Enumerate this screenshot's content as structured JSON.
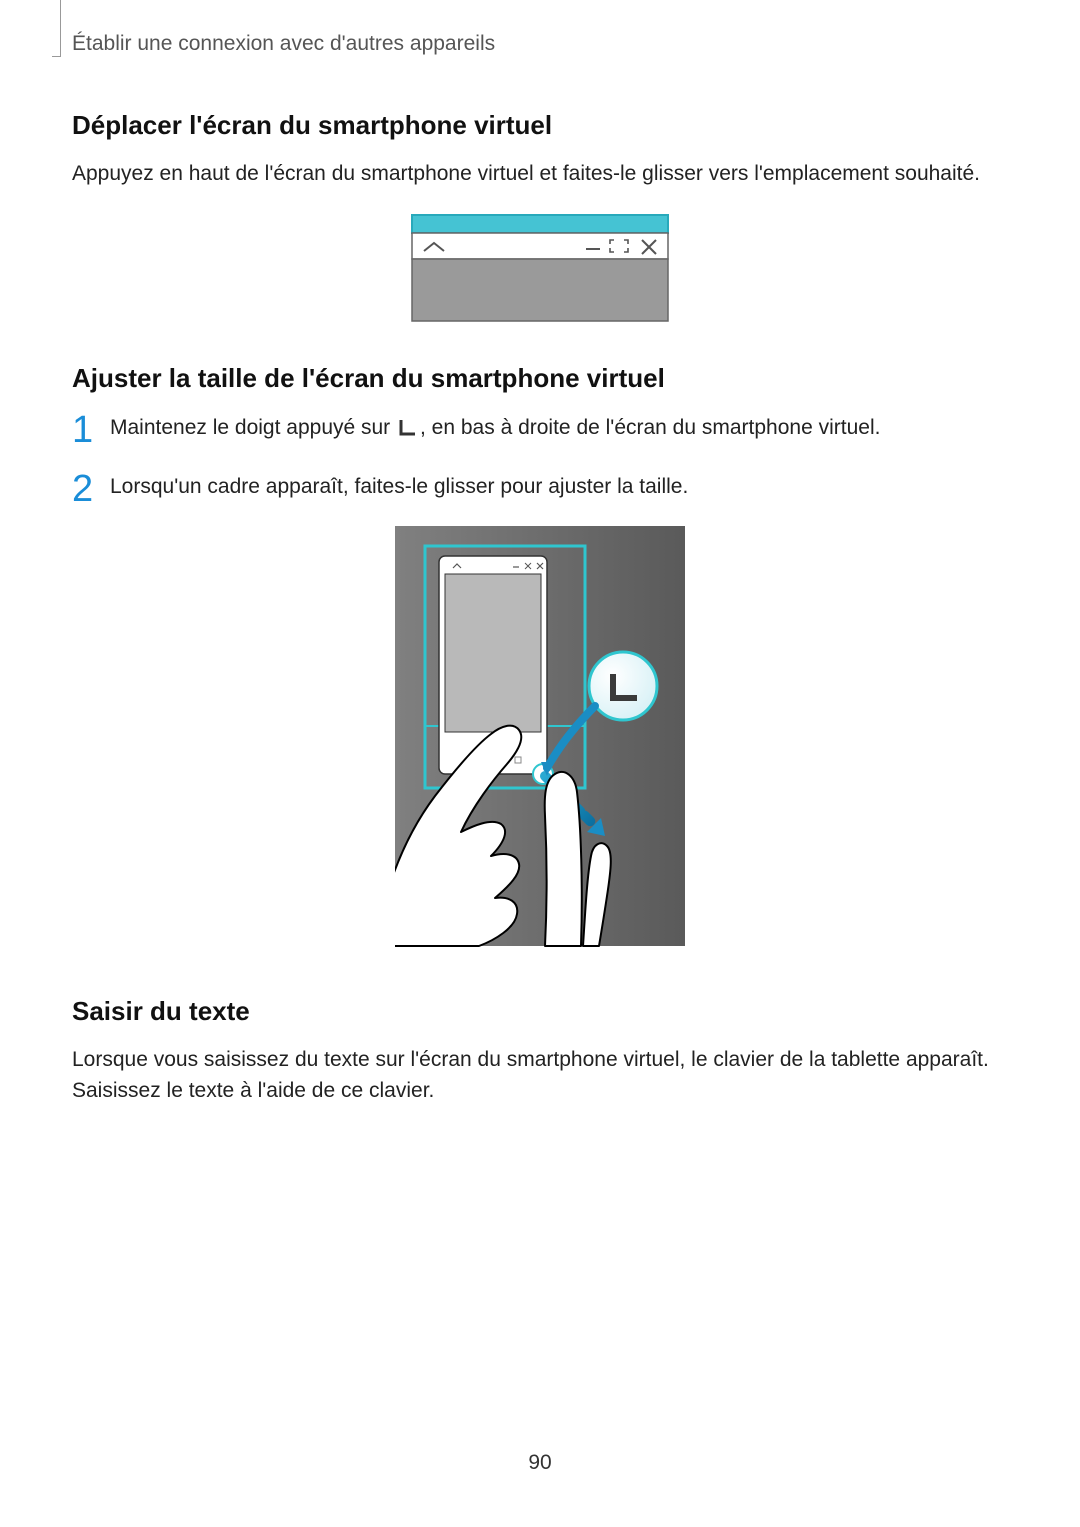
{
  "breadcrumb": "Établir une connexion avec d'autres appareils",
  "section1": {
    "heading": "Déplacer l'écran du smartphone virtuel",
    "body": "Appuyez en haut de l'écran du smartphone virtuel et faites-le glisser vers l'emplacement souhaité."
  },
  "section2": {
    "heading": "Ajuster la taille de l'écran du smartphone virtuel",
    "step1_pre": "Maintenez le doigt appuyé sur ",
    "step1_post": ", en bas à droite de l'écran du smartphone virtuel.",
    "step2": "Lorsqu'un cadre apparaît, faites-le glisser pour ajuster la taille."
  },
  "section3": {
    "heading": "Saisir du texte",
    "body": "Lorsque vous saisissez du texte sur l'écran du smartphone virtuel, le clavier de la tablette apparaît. Saisissez le texte à l'aide de ce clavier."
  },
  "page_number": "90"
}
